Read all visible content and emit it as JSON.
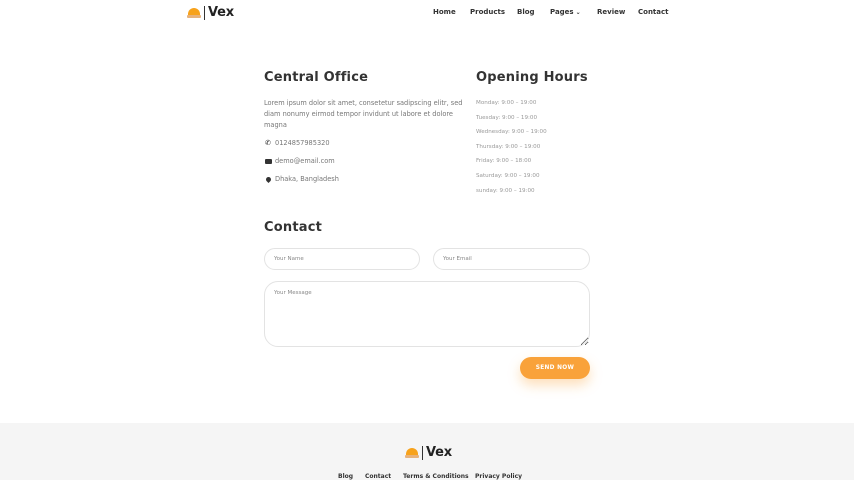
{
  "header": {
    "logo_text": "Vex",
    "nav": [
      {
        "label": "Home"
      },
      {
        "label": "Products"
      },
      {
        "label": "Blog"
      },
      {
        "label": "Pages"
      },
      {
        "label": "Review"
      },
      {
        "label": "Contact"
      }
    ]
  },
  "office": {
    "title": "Central Office",
    "description": "Lorem ipsum dolor sit amet, consetetur sadipscing elitr, sed diam nonumy eirmod tempor invidunt ut labore et dolore magna",
    "phone": "0124857985320",
    "email": "demo@email.com",
    "address": "Dhaka, Bangladesh"
  },
  "hours": {
    "title": "Opening Hours",
    "items": [
      "Monday: 9:00 – 19:00",
      "Tuesday: 9:00 – 19:00",
      "Wednesday: 9:00 – 19:00",
      "Thursday: 9:00 – 19:00",
      "Friday: 9:00 – 18:00",
      "Saturday: 9:00 – 19:00",
      "sunday: 9:00 – 19:00"
    ]
  },
  "contact": {
    "title": "Contact",
    "name_placeholder": "Your Name",
    "email_placeholder": "Your Email",
    "message_placeholder": "Your Message",
    "send_label": "SEND NOW"
  },
  "footer": {
    "logo_text": "Vex",
    "links": [
      {
        "label": "Blog"
      },
      {
        "label": "Contact"
      },
      {
        "label": "Terms & Conditions"
      },
      {
        "label": "Privacy Policy"
      }
    ]
  },
  "colors": {
    "accent": "#f9a23a",
    "footer_bg": "#f5f5f5",
    "text": "#333333"
  }
}
